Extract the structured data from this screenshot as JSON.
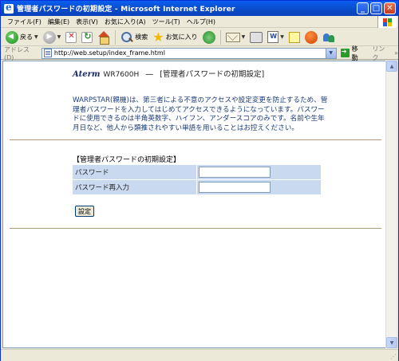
{
  "window": {
    "title": "管理者パスワードの初期設定 - Microsoft Internet Explorer",
    "controls": [
      "_",
      "□",
      "✕"
    ]
  },
  "menu": [
    "ファイル(F)",
    "編集(E)",
    "表示(V)",
    "お気に入り(A)",
    "ツール(T)",
    "ヘルプ(H)"
  ],
  "toolbar": {
    "back_label": "戻る",
    "search_label": "検索",
    "favorites_label": "お気に入り"
  },
  "address": {
    "label": "アドレス(D)",
    "url": "http://web.setup/index_frame.html",
    "go_label": "移動",
    "links_label": "リンク"
  },
  "page": {
    "brand": "Aterm",
    "model": "WR7600H",
    "dash": "—",
    "heading": "[管理者パスワードの初期設定]",
    "notice": "WARPSTAR(親機)は、第三者による不意のアクセスや設定変更を防止するため、管理者パスワードを入力してはじめてアクセスできるようになっています。パスワードに使用できるのは半角英数字、ハイフン、アンダースコアのみです。名前や生年月日など、他人から類推されやすい単語を用いることはお控えください。",
    "form_title": "【管理者パスワードの初期設定】",
    "fields": [
      {
        "label": "パスワード",
        "value": ""
      },
      {
        "label": "パスワード再入力",
        "value": ""
      }
    ],
    "submit_label": "設定"
  },
  "colors": {
    "titlebar": "#0b4fd0",
    "notice_text": "#1a3a7a",
    "form_row_bg": "#c9d9ef",
    "separator": "#b09878"
  }
}
